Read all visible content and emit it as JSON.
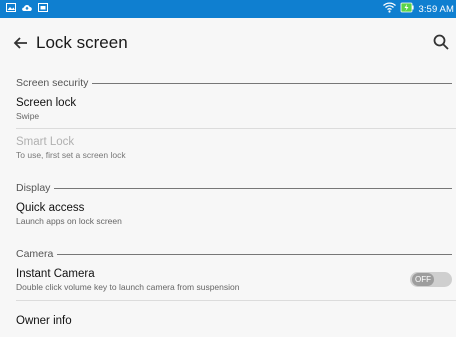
{
  "status_bar": {
    "time": "3:59 AM",
    "left_icons": [
      "gallery-icon",
      "cloud-upload-icon",
      "sim-icon"
    ],
    "right_icons": [
      "wifi-icon",
      "battery-charging-icon"
    ],
    "accent": "#0f7fd0"
  },
  "header": {
    "title": "Lock screen",
    "back_icon": "arrow-left-icon",
    "search_icon": "search-icon"
  },
  "sections": {
    "screen_security": "Screen security",
    "display": "Display",
    "camera": "Camera"
  },
  "items": {
    "screen_lock": {
      "title": "Screen lock",
      "subtitle": "Swipe"
    },
    "smart_lock": {
      "title": "Smart Lock",
      "subtitle": "To use, first set a screen lock"
    },
    "quick_access": {
      "title": "Quick access",
      "subtitle": "Launch apps on lock screen"
    },
    "instant_camera": {
      "title": "Instant Camera",
      "subtitle": "Double click volume key to launch camera from suspension",
      "toggle_label": "OFF",
      "enabled": false
    },
    "owner_info": {
      "title": "Owner info"
    }
  }
}
